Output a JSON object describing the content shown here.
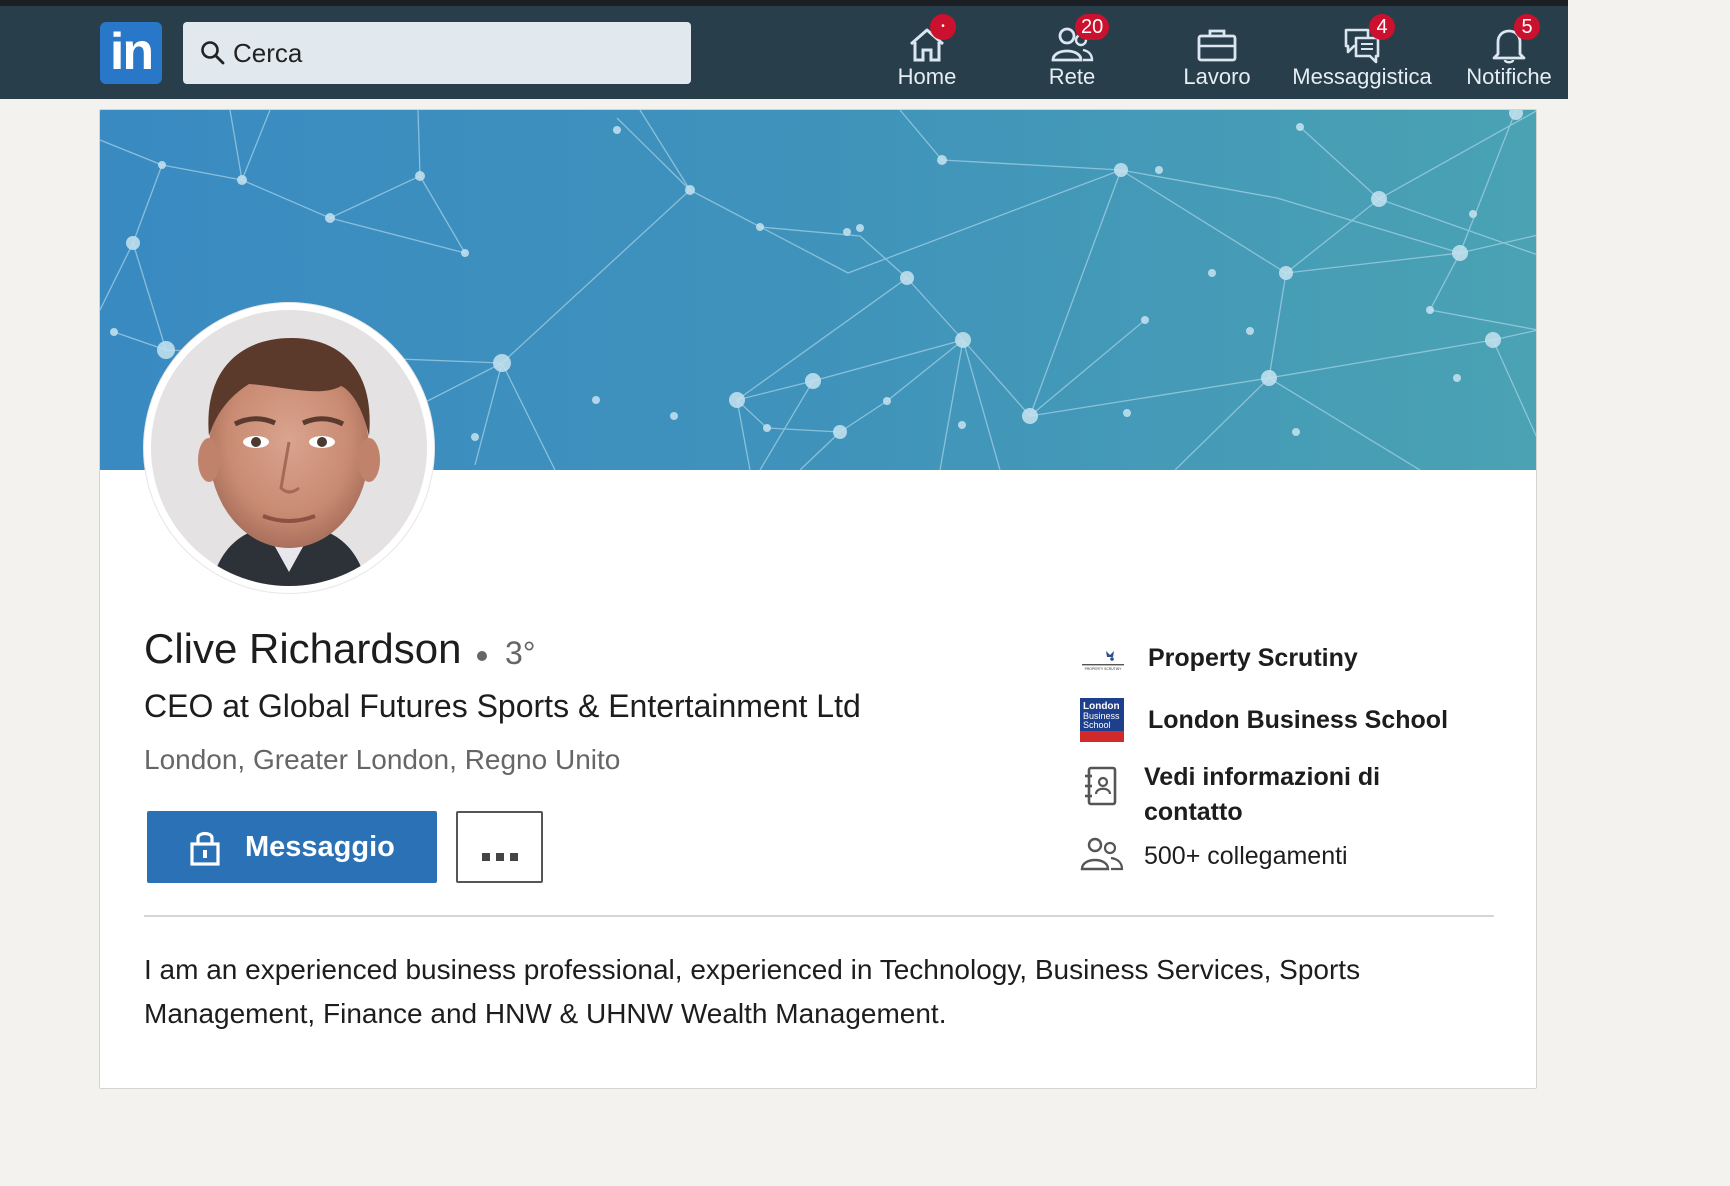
{
  "topbar": {
    "logo_text": "in",
    "search": {
      "placeholder": "Cerca",
      "value": ""
    },
    "nav": [
      {
        "label": "Home",
        "icon": "home-icon",
        "badge": "•"
      },
      {
        "label": "Rete",
        "icon": "network-icon",
        "badge": "20"
      },
      {
        "label": "Lavoro",
        "icon": "briefcase-icon",
        "badge": ""
      },
      {
        "label": "Messaggistica",
        "icon": "messaging-icon",
        "badge": "4"
      },
      {
        "label": "Notifiche",
        "icon": "bell-icon",
        "badge": "5"
      }
    ]
  },
  "profile": {
    "name": "Clive Richardson",
    "degree": "3°",
    "headline": "CEO at Global Futures Sports & Entertainment Ltd",
    "location": "London, Greater London, Regno Unito",
    "message_button": "Messaggio",
    "more_button": "...",
    "sidebar": {
      "company": "Property Scrutiny",
      "company_logo_text": "PROPERTY SCRUTINY",
      "school": "London Business School",
      "school_logo_text": [
        "London",
        "Business",
        "School"
      ],
      "contact_info": "Vedi informazioni di contatto",
      "contact_info_lines": [
        "Vedi informazioni di",
        "contatto"
      ],
      "connections": "500+ collegamenti"
    },
    "summary_lines": [
      "I am an experienced business professional, experienced in Technology, Business Services, Sports",
      "Management, Finance and HNW & UHNW Wealth Management."
    ]
  },
  "colors": {
    "topbar": "#283e4a",
    "accent_blue": "#2a72b5",
    "badge_red": "#cb112d",
    "banner_from": "#3b8bc2",
    "banner_to": "#4aa3b5"
  }
}
